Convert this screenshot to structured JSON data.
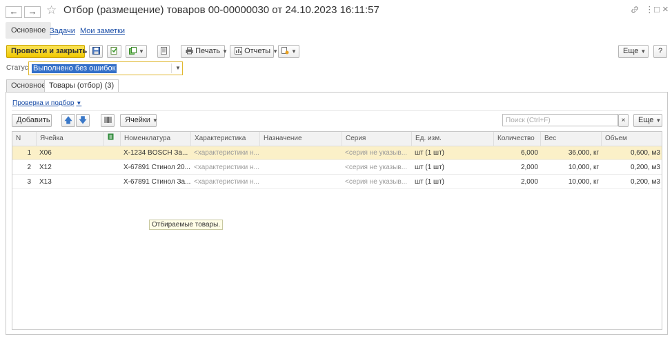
{
  "window": {
    "title": "Отбор (размещение) товаров 00-00000030 от 24.10.2023 16:11:57",
    "back_icon": "←",
    "forward_icon": "→",
    "star_icon": "☆",
    "link_icon": "🔗",
    "menu_icon": "⋮",
    "maximize_icon": "□",
    "close_icon": "×"
  },
  "subnav": {
    "main": "Основное",
    "tasks": "Задачи",
    "notes": "Мои заметки"
  },
  "toolbar": {
    "post_close": "Провести и закрыть",
    "print": "Печать",
    "reports": "Отчеты",
    "more": "Еще",
    "help": "?"
  },
  "status": {
    "label": "Статус:",
    "value": "Выполнено без ошибок"
  },
  "tabs": [
    {
      "label": "Основное"
    },
    {
      "label": "Товары (отбор) (3)"
    }
  ],
  "goods": {
    "check_link": "Проверка и подбор",
    "add": "Добавить",
    "cells": "Ячейки",
    "search_placeholder": "Поиск (Ctrl+F)",
    "clear": "×",
    "more": "Еще",
    "columns": [
      "N",
      "Ячейка",
      "",
      "Номенклатура",
      "Характеристика",
      "Назначение",
      "Серия",
      "Ед. изм.",
      "Количество",
      "Вес",
      "Объем"
    ],
    "rows": [
      {
        "n": "1",
        "cell": "X06",
        "item": "X-1234 BOSCH За...",
        "char": "<характеристики н...",
        "purpose": "",
        "series": "<серия не указыв...",
        "unit": "шт (1 шт)",
        "qty": "6,000",
        "weight": "36,000, кг",
        "volume": "0,600, м3"
      },
      {
        "n": "2",
        "cell": "X12",
        "item": "X-67891 Стинол 20...",
        "char": "<характеристики н...",
        "purpose": "",
        "series": "<серия не указыв...",
        "unit": "шт (1 шт)",
        "qty": "2,000",
        "weight": "10,000, кг",
        "volume": "0,200, м3"
      },
      {
        "n": "3",
        "cell": "X13",
        "item": "X-67891 Стинол За...",
        "char": "<характеристики н...",
        "purpose": "",
        "series": "<серия не указыв...",
        "unit": "шт (1 шт)",
        "qty": "2,000",
        "weight": "10,000, кг",
        "volume": "0,200, м3"
      }
    ],
    "tooltip": "Отбираемые товары."
  },
  "colors": {
    "accent": "#f0c900",
    "link": "#1c4fa8",
    "selected_row": "#fbf0c8"
  }
}
